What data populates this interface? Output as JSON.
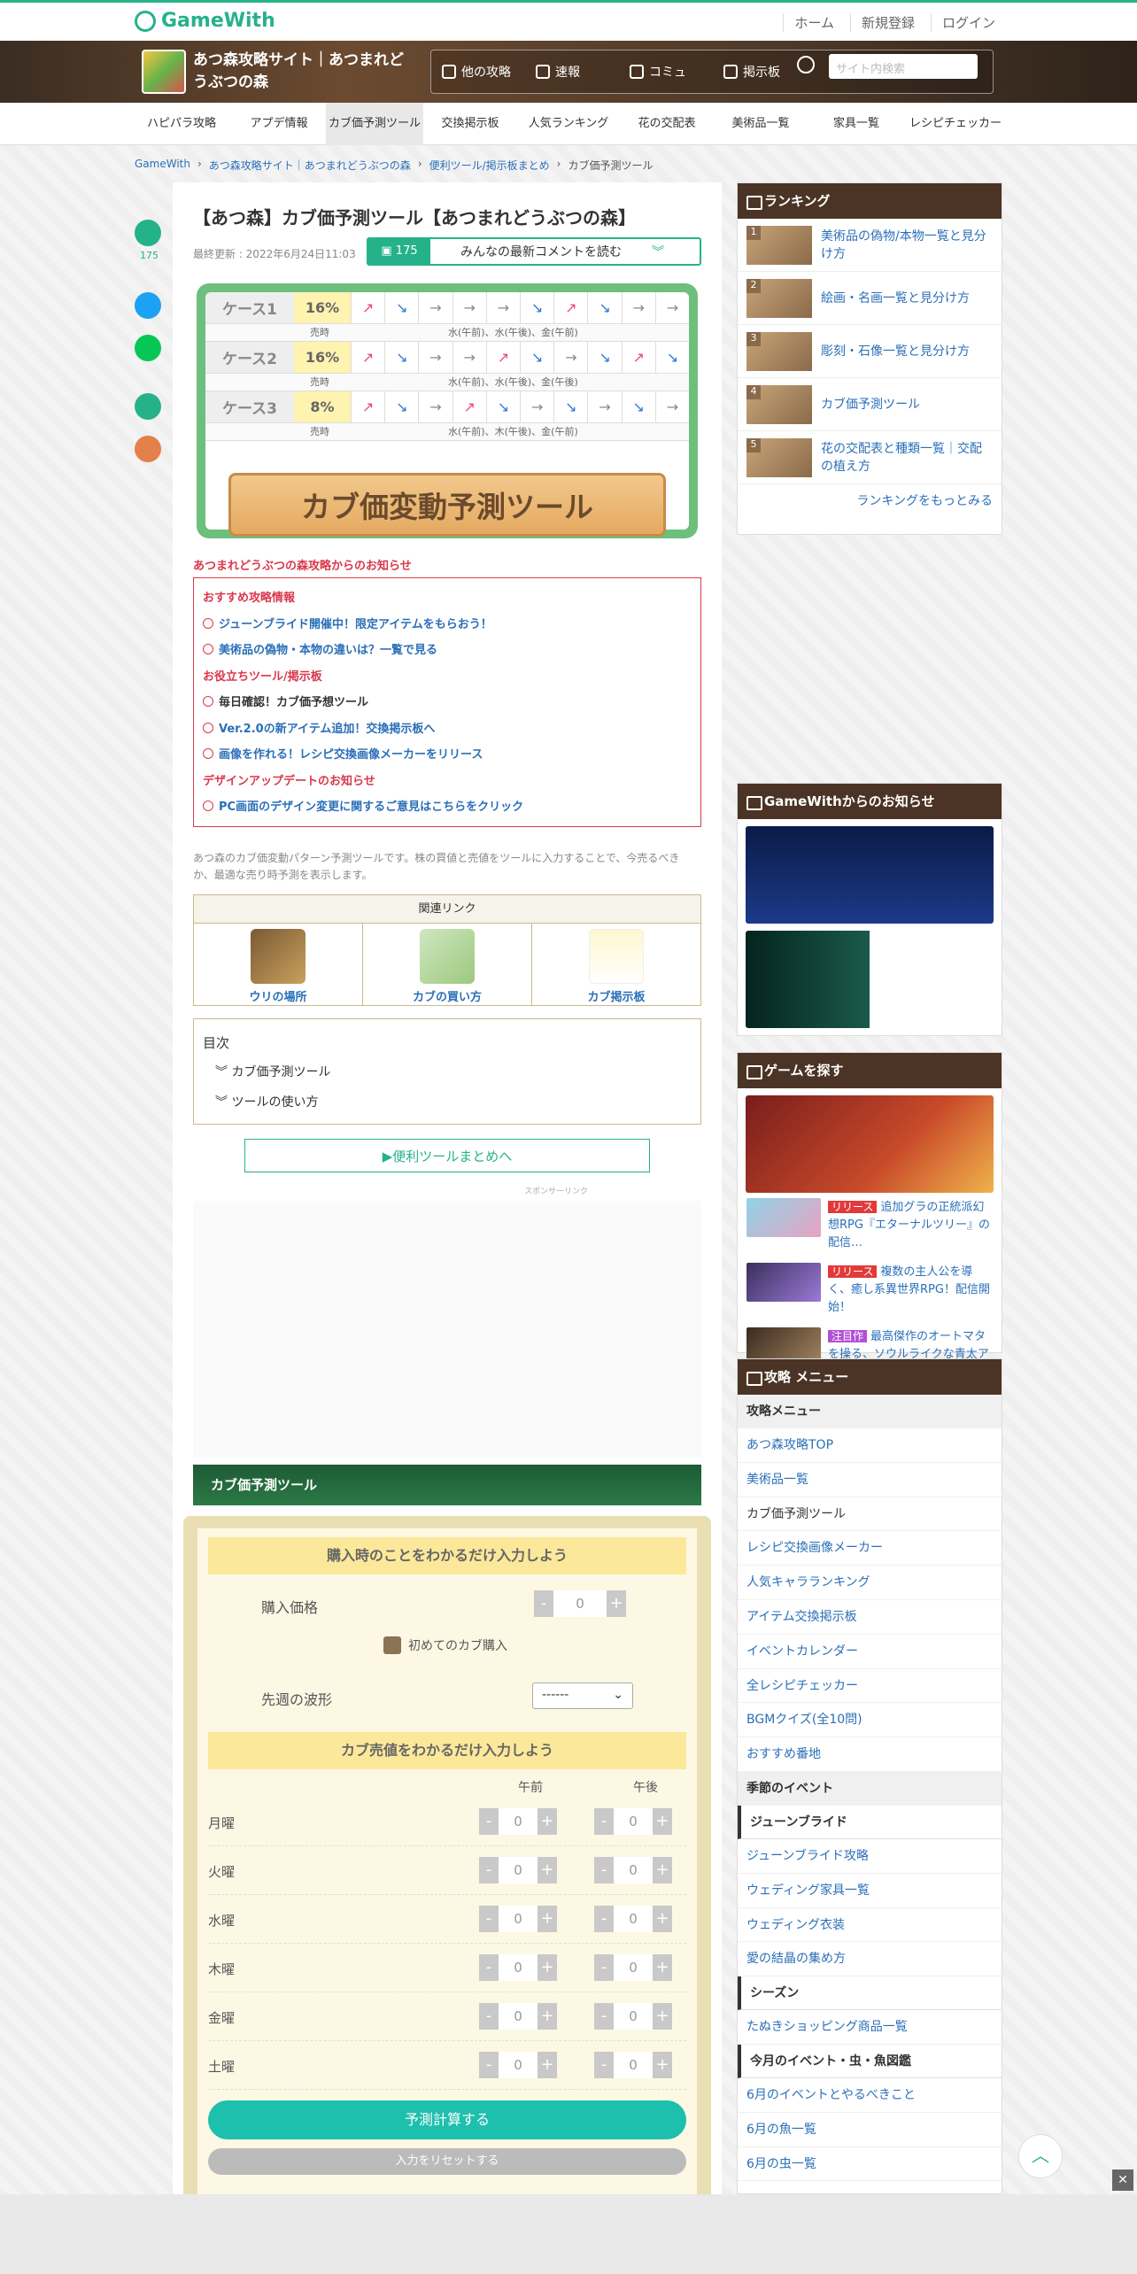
{
  "site": {
    "logo": "GameWith",
    "top_links": [
      "ホーム",
      "新規登録",
      "ログイン"
    ]
  },
  "game": {
    "title": "あつ森攻略サイト｜あつまれどうぶつの森",
    "nav": [
      "他の攻略",
      "速報",
      "コミュ",
      "掲示板"
    ],
    "search_placeholder": "サイト内検索"
  },
  "menu": [
    "ハピパラ攻略",
    "アプデ情報",
    "カブ価予測ツール",
    "交換掲示板",
    "人気ランキング",
    "花の交配表",
    "美術品一覧",
    "家具一覧",
    "レシピチェッカー"
  ],
  "breadcrumb": [
    "GameWith",
    "あつ森攻略サイト｜あつまれどうぶつの森",
    "便利ツール/掲示板まとめ",
    "カブ価予測ツール"
  ],
  "article": {
    "title": "【あつ森】カブ価予測ツール【あつまれどうぶつの森】",
    "updated": "最終更新 : 2022年6月24日11:03",
    "comment_count": "175",
    "comment_label": "みんなの最新コメントを読む"
  },
  "banner": {
    "cases": [
      {
        "name": "ケース1",
        "pct": "16%",
        "arrows": [
          "↗",
          "↘",
          "→",
          "→",
          "→",
          "↘",
          "↗",
          "↘",
          "→",
          "→"
        ],
        "sell": "水(午前)、水(午後)、金(午前)"
      },
      {
        "name": "ケース2",
        "pct": "16%",
        "arrows": [
          "↗",
          "↘",
          "→",
          "→",
          "↗",
          "↘",
          "→",
          "↘",
          "↗",
          "↘"
        ],
        "sell": "水(午前)、水(午後)、金(午後)"
      },
      {
        "name": "ケース3",
        "pct": "8%",
        "arrows": [
          "↗",
          "↘",
          "→",
          "↗",
          "↘",
          "→",
          "↘",
          "→",
          "↘",
          "→"
        ],
        "sell": "水(午前)、木(午後)、金(午前)"
      }
    ],
    "sell_label": "売時",
    "plank": "カブ価変動予測ツール"
  },
  "notice": {
    "header": "あつまれどうぶつの森攻略からのお知らせ",
    "lines": [
      {
        "type": "sec",
        "text": "おすすめ攻略情報"
      },
      {
        "type": "lk",
        "text": "ジューンブライド開催中！限定アイテムをもらおう！"
      },
      {
        "type": "lk",
        "text": "美術品の偽物・本物の違いは？一覧で見る"
      },
      {
        "type": "sec",
        "text": "お役立ちツール/掲示板"
      },
      {
        "type": "plain",
        "text": "毎日確認！カブ価予想ツール"
      },
      {
        "type": "lk",
        "text": "Ver.2.0の新アイテム追加！交換掲示板へ"
      },
      {
        "type": "lk",
        "text": "画像を作れる！レシピ交換画像メーカーをリリース"
      },
      {
        "type": "sec",
        "text": "デザインアップデートのお知らせ"
      },
      {
        "type": "lk",
        "text": "PC画面のデザイン変更に関するご意見はこちらをクリック"
      }
    ]
  },
  "description": "あつ森のカブ価変動パターン予測ツールです。株の買値と売値をツールに入力することで、今売るべきか、最適な売り時予測を表示します。",
  "related": {
    "header": "関連リンク",
    "items": [
      "ウリの場所",
      "カブの買い方",
      "カブ掲示板"
    ]
  },
  "toc": {
    "title": "目次",
    "items": [
      "カブ価予測ツール",
      "ツールの使い方"
    ]
  },
  "tools_button": "▶便利ツールまとめへ",
  "sponsor": "スポンサーリンク",
  "tool": {
    "heading": "カブ価予測ツール",
    "buy_header": "購入時のことをわかるだけ入力しよう",
    "buy_price_label": "購入価格",
    "first_time": "初めてのカブ購入",
    "pattern_label": "先週の波形",
    "pattern_value": "------",
    "sell_header": "カブ売値をわかるだけ入力しよう",
    "am": "午前",
    "pm": "午後",
    "days": [
      "月曜",
      "火曜",
      "水曜",
      "木曜",
      "金曜",
      "土曜"
    ],
    "default_value": "0",
    "calc": "予測計算する",
    "reset": "入力をリセットする"
  },
  "ranking": {
    "title": "ランキング",
    "items": [
      "美術品の偽物/本物一覧と見分け方",
      "絵画・名画一覧と見分け方",
      "彫刻・石像一覧と見分け方",
      "カブ価予測ツール",
      "花の交配表と種類一覧｜交配の植え方"
    ],
    "more": "ランキングをもっとみる"
  },
  "gw_news": {
    "title": "GameWithからのお知らせ"
  },
  "find_game": {
    "title": "ゲームを探す",
    "items": [
      {
        "tag": "リリース",
        "text": "追加グラの正統派幻想RPG『エターナルツリー』の配信…"
      },
      {
        "tag": "リリース",
        "text": "複数の主人公を導く、癒し系異世界RPG！配信開始！"
      },
      {
        "tag": "注目作",
        "text": "最高傑作のオートマタを操る、ソウルライクな青太アクシ…"
      }
    ]
  },
  "side_menu": {
    "title": "攻略 メニュー",
    "sub_title": "攻略メニュー",
    "items": [
      "あつ森攻略TOP",
      "美術品一覧",
      "カブ価予測ツール",
      "レシピ交換画像メーカー",
      "人気キャラランキング",
      "アイテム交換掲示板",
      "イベントカレンダー",
      "全レシピチェッカー",
      "BGMクイズ(全10問)",
      "おすすめ番地"
    ],
    "season_title": "季節のイベント",
    "june": "ジューンブライド",
    "june_items": [
      "ジューンブライド攻略",
      "ウェディング家具一覧",
      "ウェディング衣装",
      "愛の結晶の集め方"
    ],
    "season": "シーズン",
    "season_items": [
      "たぬきショッピング商品一覧"
    ],
    "monthly": "今月のイベント・虫・魚図鑑",
    "monthly_items": [
      "6月のイベントとやるべきこと",
      "6月の魚一覧",
      "6月の虫一覧"
    ]
  },
  "colors": {
    "accent": "#25b28a",
    "brown": "#4b3425",
    "red": "#d9384b"
  }
}
